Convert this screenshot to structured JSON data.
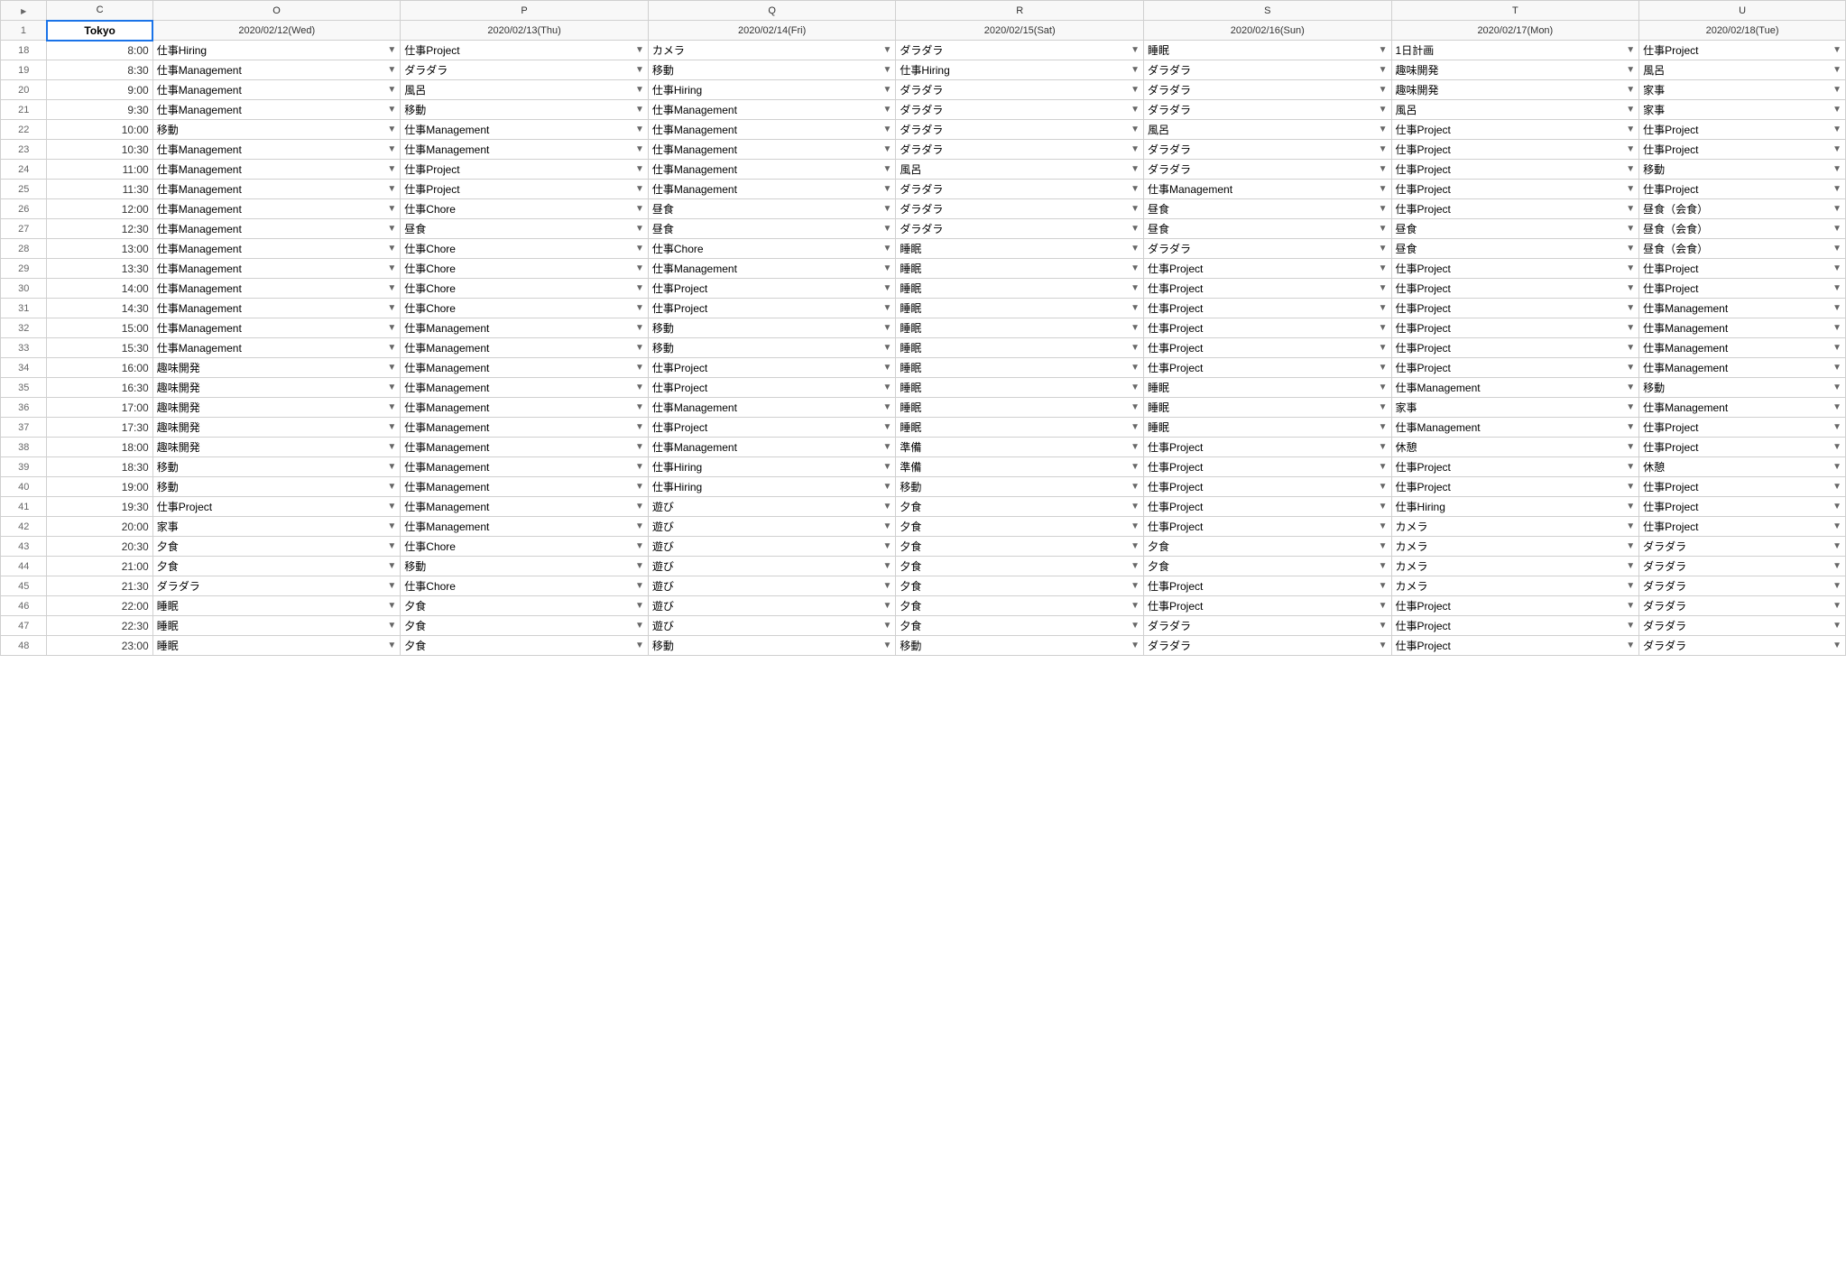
{
  "columns": {
    "rowNum": "",
    "c": "C",
    "o": "O",
    "p": "P",
    "q": "Q",
    "r": "R",
    "s": "S",
    "t": "T",
    "u": "U"
  },
  "headers": {
    "row1_c": "Tokyo",
    "row1_o": "2020/02/12(Wed)",
    "row1_p": "2020/02/13(Thu)",
    "row1_q": "2020/02/14(Fri)",
    "row1_r": "2020/02/15(Sat)",
    "row1_s": "2020/02/16(Sun)",
    "row1_t": "2020/02/17(Mon)",
    "row1_u": "2020/02/18(Tue)"
  },
  "rows": [
    {
      "num": 18,
      "time": "8:00",
      "o": "仕事Hiring",
      "p": "仕事Project",
      "q": "カメラ",
      "r": "ダラダラ",
      "s": "睡眠",
      "t": "1日計画",
      "u": "仕事Project"
    },
    {
      "num": 19,
      "time": "8:30",
      "o": "仕事Management",
      "p": "ダラダラ",
      "q": "移動",
      "r": "仕事Hiring",
      "s": "ダラダラ",
      "t": "趣味開発",
      "u": "風呂"
    },
    {
      "num": 20,
      "time": "9:00",
      "o": "仕事Management",
      "p": "風呂",
      "q": "仕事Hiring",
      "r": "ダラダラ",
      "s": "ダラダラ",
      "t": "趣味開発",
      "u": "家事"
    },
    {
      "num": 21,
      "time": "9:30",
      "o": "仕事Management",
      "p": "移動",
      "q": "仕事Management",
      "r": "ダラダラ",
      "s": "ダラダラ",
      "t": "風呂",
      "u": "家事"
    },
    {
      "num": 22,
      "time": "10:00",
      "o": "移動",
      "p": "仕事Management",
      "q": "仕事Management",
      "r": "ダラダラ",
      "s": "風呂",
      "t": "仕事Project",
      "u": "仕事Project"
    },
    {
      "num": 23,
      "time": "10:30",
      "o": "仕事Management",
      "p": "仕事Management",
      "q": "仕事Management",
      "r": "ダラダラ",
      "s": "ダラダラ",
      "t": "仕事Project",
      "u": "仕事Project"
    },
    {
      "num": 24,
      "time": "11:00",
      "o": "仕事Management",
      "p": "仕事Project",
      "q": "仕事Management",
      "r": "風呂",
      "s": "ダラダラ",
      "t": "仕事Project",
      "u": "移動"
    },
    {
      "num": 25,
      "time": "11:30",
      "o": "仕事Management",
      "p": "仕事Project",
      "q": "仕事Management",
      "r": "ダラダラ",
      "s": "仕事Management",
      "t": "仕事Project",
      "u": "仕事Project"
    },
    {
      "num": 26,
      "time": "12:00",
      "o": "仕事Management",
      "p": "仕事Chore",
      "q": "昼食",
      "r": "ダラダラ",
      "s": "昼食",
      "t": "仕事Project",
      "u": "昼食（会食）"
    },
    {
      "num": 27,
      "time": "12:30",
      "o": "仕事Management",
      "p": "昼食",
      "q": "昼食",
      "r": "ダラダラ",
      "s": "昼食",
      "t": "昼食",
      "u": "昼食（会食）"
    },
    {
      "num": 28,
      "time": "13:00",
      "o": "仕事Management",
      "p": "仕事Chore",
      "q": "仕事Chore",
      "r": "睡眠",
      "s": "ダラダラ",
      "t": "昼食",
      "u": "昼食（会食）"
    },
    {
      "num": 29,
      "time": "13:30",
      "o": "仕事Management",
      "p": "仕事Chore",
      "q": "仕事Management",
      "r": "睡眠",
      "s": "仕事Project",
      "t": "仕事Project",
      "u": "仕事Project"
    },
    {
      "num": 30,
      "time": "14:00",
      "o": "仕事Management",
      "p": "仕事Chore",
      "q": "仕事Project",
      "r": "睡眠",
      "s": "仕事Project",
      "t": "仕事Project",
      "u": "仕事Project"
    },
    {
      "num": 31,
      "time": "14:30",
      "o": "仕事Management",
      "p": "仕事Chore",
      "q": "仕事Project",
      "r": "睡眠",
      "s": "仕事Project",
      "t": "仕事Project",
      "u": "仕事Management"
    },
    {
      "num": 32,
      "time": "15:00",
      "o": "仕事Management",
      "p": "仕事Management",
      "q": "移動",
      "r": "睡眠",
      "s": "仕事Project",
      "t": "仕事Project",
      "u": "仕事Management"
    },
    {
      "num": 33,
      "time": "15:30",
      "o": "仕事Management",
      "p": "仕事Management",
      "q": "移動",
      "r": "睡眠",
      "s": "仕事Project",
      "t": "仕事Project",
      "u": "仕事Management"
    },
    {
      "num": 34,
      "time": "16:00",
      "o": "趣味開発",
      "p": "仕事Management",
      "q": "仕事Project",
      "r": "睡眠",
      "s": "仕事Project",
      "t": "仕事Project",
      "u": "仕事Management"
    },
    {
      "num": 35,
      "time": "16:30",
      "o": "趣味開発",
      "p": "仕事Management",
      "q": "仕事Project",
      "r": "睡眠",
      "s": "睡眠",
      "t": "仕事Management",
      "u": "移動"
    },
    {
      "num": 36,
      "time": "17:00",
      "o": "趣味開発",
      "p": "仕事Management",
      "q": "仕事Management",
      "r": "睡眠",
      "s": "睡眠",
      "t": "家事",
      "u": "仕事Management"
    },
    {
      "num": 37,
      "time": "17:30",
      "o": "趣味開発",
      "p": "仕事Management",
      "q": "仕事Project",
      "r": "睡眠",
      "s": "睡眠",
      "t": "仕事Management",
      "u": "仕事Project"
    },
    {
      "num": 38,
      "time": "18:00",
      "o": "趣味開発",
      "p": "仕事Management",
      "q": "仕事Management",
      "r": "準備",
      "s": "仕事Project",
      "t": "休憩",
      "u": "仕事Project"
    },
    {
      "num": 39,
      "time": "18:30",
      "o": "移動",
      "p": "仕事Management",
      "q": "仕事Hiring",
      "r": "準備",
      "s": "仕事Project",
      "t": "仕事Project",
      "u": "休憩"
    },
    {
      "num": 40,
      "time": "19:00",
      "o": "移動",
      "p": "仕事Management",
      "q": "仕事Hiring",
      "r": "移動",
      "s": "仕事Project",
      "t": "仕事Project",
      "u": "仕事Project"
    },
    {
      "num": 41,
      "time": "19:30",
      "o": "仕事Project",
      "p": "仕事Management",
      "q": "遊び",
      "r": "夕食",
      "s": "仕事Project",
      "t": "仕事Hiring",
      "u": "仕事Project"
    },
    {
      "num": 42,
      "time": "20:00",
      "o": "家事",
      "p": "仕事Management",
      "q": "遊び",
      "r": "夕食",
      "s": "仕事Project",
      "t": "カメラ",
      "u": "仕事Project"
    },
    {
      "num": 43,
      "time": "20:30",
      "o": "夕食",
      "p": "仕事Chore",
      "q": "遊び",
      "r": "夕食",
      "s": "夕食",
      "t": "カメラ",
      "u": "ダラダラ"
    },
    {
      "num": 44,
      "time": "21:00",
      "o": "夕食",
      "p": "移動",
      "q": "遊び",
      "r": "夕食",
      "s": "夕食",
      "t": "カメラ",
      "u": "ダラダラ"
    },
    {
      "num": 45,
      "time": "21:30",
      "o": "ダラダラ",
      "p": "仕事Chore",
      "q": "遊び",
      "r": "夕食",
      "s": "仕事Project",
      "t": "カメラ",
      "u": "ダラダラ"
    },
    {
      "num": 46,
      "time": "22:00",
      "o": "睡眠",
      "p": "夕食",
      "q": "遊び",
      "r": "夕食",
      "s": "仕事Project",
      "t": "仕事Project",
      "u": "ダラダラ"
    },
    {
      "num": 47,
      "time": "22:30",
      "o": "睡眠",
      "p": "夕食",
      "q": "遊び",
      "r": "夕食",
      "s": "ダラダラ",
      "t": "仕事Project",
      "u": "ダラダラ"
    },
    {
      "num": 48,
      "time": "23:00",
      "o": "睡眠",
      "p": "夕食",
      "q": "移動",
      "r": "移動",
      "s": "ダラダラ",
      "t": "仕事Project",
      "u": "ダラダラ"
    }
  ],
  "dropdown_arrow": "▼",
  "ui": {
    "row_1_label": "1"
  }
}
